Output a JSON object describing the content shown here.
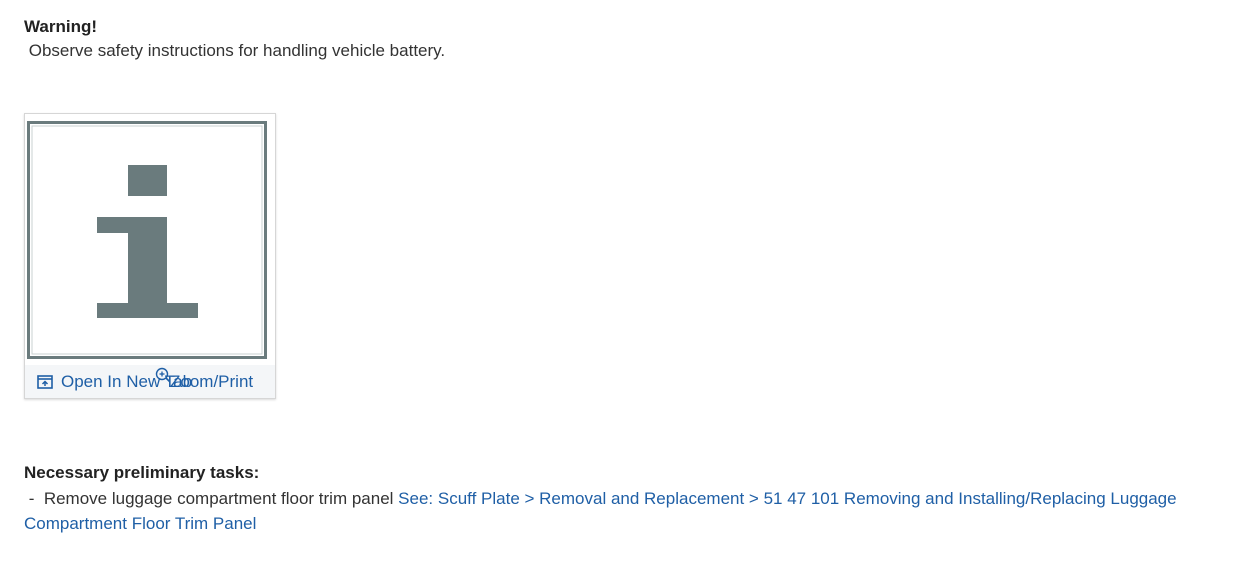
{
  "warning": {
    "title": "Warning!",
    "text": " Observe safety instructions for handling vehicle battery."
  },
  "figure": {
    "icon": "info-icon",
    "open_in_new_tab_label": "Open In New Tab",
    "zoom_print_label": "Zoom/Print",
    "colors": {
      "icon_fill": "#6a7b7d",
      "link": "#1f5fa6"
    }
  },
  "preliminary": {
    "title": "Necessary preliminary tasks:",
    "item_text": " -  Remove luggage compartment floor trim panel ",
    "link_text": "See: Scuff Plate > Removal and Replacement > 51 47 101 Removing and Installing/Replacing Luggage Compartment Floor Trim Panel"
  }
}
